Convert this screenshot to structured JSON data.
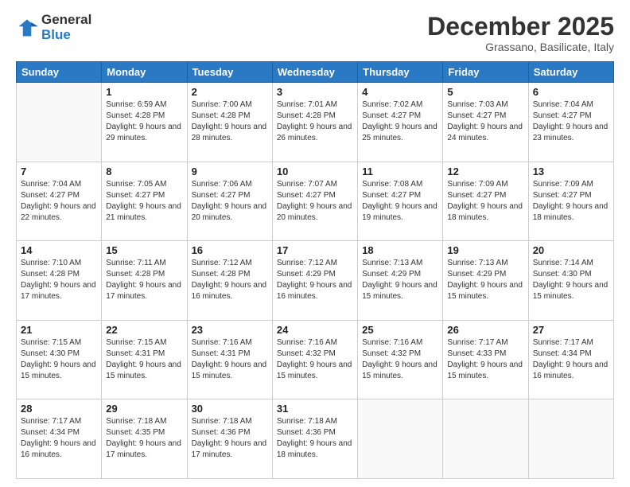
{
  "logo": {
    "line1": "General",
    "line2": "Blue"
  },
  "title": "December 2025",
  "location": "Grassano, Basilicate, Italy",
  "weekdays": [
    "Sunday",
    "Monday",
    "Tuesday",
    "Wednesday",
    "Thursday",
    "Friday",
    "Saturday"
  ],
  "weeks": [
    [
      {
        "day": "",
        "sunrise": "",
        "sunset": "",
        "daylight": ""
      },
      {
        "day": "1",
        "sunrise": "Sunrise: 6:59 AM",
        "sunset": "Sunset: 4:28 PM",
        "daylight": "Daylight: 9 hours and 29 minutes."
      },
      {
        "day": "2",
        "sunrise": "Sunrise: 7:00 AM",
        "sunset": "Sunset: 4:28 PM",
        "daylight": "Daylight: 9 hours and 28 minutes."
      },
      {
        "day": "3",
        "sunrise": "Sunrise: 7:01 AM",
        "sunset": "Sunset: 4:28 PM",
        "daylight": "Daylight: 9 hours and 26 minutes."
      },
      {
        "day": "4",
        "sunrise": "Sunrise: 7:02 AM",
        "sunset": "Sunset: 4:27 PM",
        "daylight": "Daylight: 9 hours and 25 minutes."
      },
      {
        "day": "5",
        "sunrise": "Sunrise: 7:03 AM",
        "sunset": "Sunset: 4:27 PM",
        "daylight": "Daylight: 9 hours and 24 minutes."
      },
      {
        "day": "6",
        "sunrise": "Sunrise: 7:04 AM",
        "sunset": "Sunset: 4:27 PM",
        "daylight": "Daylight: 9 hours and 23 minutes."
      }
    ],
    [
      {
        "day": "7",
        "sunrise": "Sunrise: 7:04 AM",
        "sunset": "Sunset: 4:27 PM",
        "daylight": "Daylight: 9 hours and 22 minutes."
      },
      {
        "day": "8",
        "sunrise": "Sunrise: 7:05 AM",
        "sunset": "Sunset: 4:27 PM",
        "daylight": "Daylight: 9 hours and 21 minutes."
      },
      {
        "day": "9",
        "sunrise": "Sunrise: 7:06 AM",
        "sunset": "Sunset: 4:27 PM",
        "daylight": "Daylight: 9 hours and 20 minutes."
      },
      {
        "day": "10",
        "sunrise": "Sunrise: 7:07 AM",
        "sunset": "Sunset: 4:27 PM",
        "daylight": "Daylight: 9 hours and 20 minutes."
      },
      {
        "day": "11",
        "sunrise": "Sunrise: 7:08 AM",
        "sunset": "Sunset: 4:27 PM",
        "daylight": "Daylight: 9 hours and 19 minutes."
      },
      {
        "day": "12",
        "sunrise": "Sunrise: 7:09 AM",
        "sunset": "Sunset: 4:27 PM",
        "daylight": "Daylight: 9 hours and 18 minutes."
      },
      {
        "day": "13",
        "sunrise": "Sunrise: 7:09 AM",
        "sunset": "Sunset: 4:27 PM",
        "daylight": "Daylight: 9 hours and 18 minutes."
      }
    ],
    [
      {
        "day": "14",
        "sunrise": "Sunrise: 7:10 AM",
        "sunset": "Sunset: 4:28 PM",
        "daylight": "Daylight: 9 hours and 17 minutes."
      },
      {
        "day": "15",
        "sunrise": "Sunrise: 7:11 AM",
        "sunset": "Sunset: 4:28 PM",
        "daylight": "Daylight: 9 hours and 17 minutes."
      },
      {
        "day": "16",
        "sunrise": "Sunrise: 7:12 AM",
        "sunset": "Sunset: 4:28 PM",
        "daylight": "Daylight: 9 hours and 16 minutes."
      },
      {
        "day": "17",
        "sunrise": "Sunrise: 7:12 AM",
        "sunset": "Sunset: 4:29 PM",
        "daylight": "Daylight: 9 hours and 16 minutes."
      },
      {
        "day": "18",
        "sunrise": "Sunrise: 7:13 AM",
        "sunset": "Sunset: 4:29 PM",
        "daylight": "Daylight: 9 hours and 15 minutes."
      },
      {
        "day": "19",
        "sunrise": "Sunrise: 7:13 AM",
        "sunset": "Sunset: 4:29 PM",
        "daylight": "Daylight: 9 hours and 15 minutes."
      },
      {
        "day": "20",
        "sunrise": "Sunrise: 7:14 AM",
        "sunset": "Sunset: 4:30 PM",
        "daylight": "Daylight: 9 hours and 15 minutes."
      }
    ],
    [
      {
        "day": "21",
        "sunrise": "Sunrise: 7:15 AM",
        "sunset": "Sunset: 4:30 PM",
        "daylight": "Daylight: 9 hours and 15 minutes."
      },
      {
        "day": "22",
        "sunrise": "Sunrise: 7:15 AM",
        "sunset": "Sunset: 4:31 PM",
        "daylight": "Daylight: 9 hours and 15 minutes."
      },
      {
        "day": "23",
        "sunrise": "Sunrise: 7:16 AM",
        "sunset": "Sunset: 4:31 PM",
        "daylight": "Daylight: 9 hours and 15 minutes."
      },
      {
        "day": "24",
        "sunrise": "Sunrise: 7:16 AM",
        "sunset": "Sunset: 4:32 PM",
        "daylight": "Daylight: 9 hours and 15 minutes."
      },
      {
        "day": "25",
        "sunrise": "Sunrise: 7:16 AM",
        "sunset": "Sunset: 4:32 PM",
        "daylight": "Daylight: 9 hours and 15 minutes."
      },
      {
        "day": "26",
        "sunrise": "Sunrise: 7:17 AM",
        "sunset": "Sunset: 4:33 PM",
        "daylight": "Daylight: 9 hours and 15 minutes."
      },
      {
        "day": "27",
        "sunrise": "Sunrise: 7:17 AM",
        "sunset": "Sunset: 4:34 PM",
        "daylight": "Daylight: 9 hours and 16 minutes."
      }
    ],
    [
      {
        "day": "28",
        "sunrise": "Sunrise: 7:17 AM",
        "sunset": "Sunset: 4:34 PM",
        "daylight": "Daylight: 9 hours and 16 minutes."
      },
      {
        "day": "29",
        "sunrise": "Sunrise: 7:18 AM",
        "sunset": "Sunset: 4:35 PM",
        "daylight": "Daylight: 9 hours and 17 minutes."
      },
      {
        "day": "30",
        "sunrise": "Sunrise: 7:18 AM",
        "sunset": "Sunset: 4:36 PM",
        "daylight": "Daylight: 9 hours and 17 minutes."
      },
      {
        "day": "31",
        "sunrise": "Sunrise: 7:18 AM",
        "sunset": "Sunset: 4:36 PM",
        "daylight": "Daylight: 9 hours and 18 minutes."
      },
      {
        "day": "",
        "sunrise": "",
        "sunset": "",
        "daylight": ""
      },
      {
        "day": "",
        "sunrise": "",
        "sunset": "",
        "daylight": ""
      },
      {
        "day": "",
        "sunrise": "",
        "sunset": "",
        "daylight": ""
      }
    ]
  ]
}
